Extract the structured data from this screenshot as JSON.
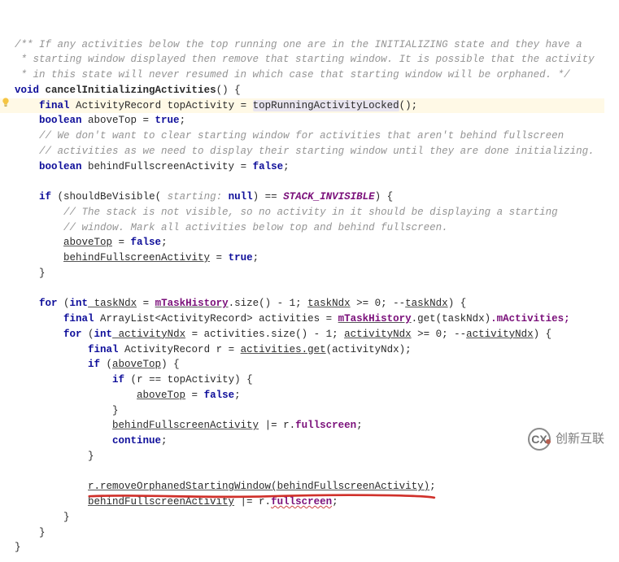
{
  "c": {
    "doc1": "/** If any activities below the top running one are in the INITIALIZING state and they have a",
    "doc2": " * starting window displayed then remove that starting window. It is possible that the activity",
    "doc3": " * in this state will never resumed in which case that starting window will be orphaned. */",
    "kw_void": "void",
    "m_cancel": "cancelInitializingActivities",
    "sig_end": "() {",
    "kw_final": "final",
    "ty_ar": "ActivityRecord",
    "v_topActivity": " topActivity = ",
    "m_topRunning": "topRunningActivityLocked",
    "call_end": "();",
    "ty_bool": "boolean",
    "v_above_decl": " aboveTop = ",
    "kw_true": "true",
    "kw_false": "false",
    "semi": ";",
    "c_noclear1": "// We don't want to clear starting window for activities that aren't behind fullscreen",
    "c_noclear2": "// activities as we need to display their starting window until they are done initializing.",
    "v_behind_decl": " behindFullscreenActivity = ",
    "kw_if": "if",
    "open_p": " (",
    "m_shouldVis": "shouldBeVisible",
    "param_ann": " starting: ",
    "kw_null": "null",
    "close_p_eq": ") == ",
    "const_stack": "STACK_INVISIBLE",
    "close_brace_o": ") {",
    "c_notvis1": "// The stack is not visible, so no activity in it should be displaying a starting",
    "c_notvis2": "// window. Mark all activities below top and behind fullscreen.",
    "v_above_assign": "aboveTop",
    "eq_sp": " = ",
    "v_behind_assign": "behindFullscreenActivity",
    "cb": "}",
    "kw_for": "for",
    "kw_int": "int",
    "v_taskNdx_decl": " taskNdx",
    "fld_mTask": "mTaskHistory",
    "m_size": ".size() - 1; ",
    "v_taskNdx": "taskNdx",
    "cond_ge0": " >= 0; --",
    "ty_al": "ArrayList<ActivityRecord>",
    "v_activities": " activities = ",
    "m_get": ".get",
    "p_taskNdx": "(taskNdx)",
    "fld_mAct": ".mActivities;",
    "v_actNdx_decl": " activityNdx",
    "eq_act_size": " = activities.size() - 1; ",
    "v_actNdx": "activityNdx",
    "v_r_decl": " r = ",
    "m_actget": "activities.get",
    "p_actNdx": "(activityNdx);",
    "v_above_cond": "aboveTop",
    "cond_openb": ") {",
    "cond_r_eq": "r == topActivity",
    "ore": " |= r.",
    "fld_full": "fullscreen",
    "kw_continue": "continue",
    "m_removeOrph": "r.removeOrphanedStartingWindow",
    "p_behind": "(behindFullscreenActivity)",
    "watermark_text": "创新互联"
  }
}
